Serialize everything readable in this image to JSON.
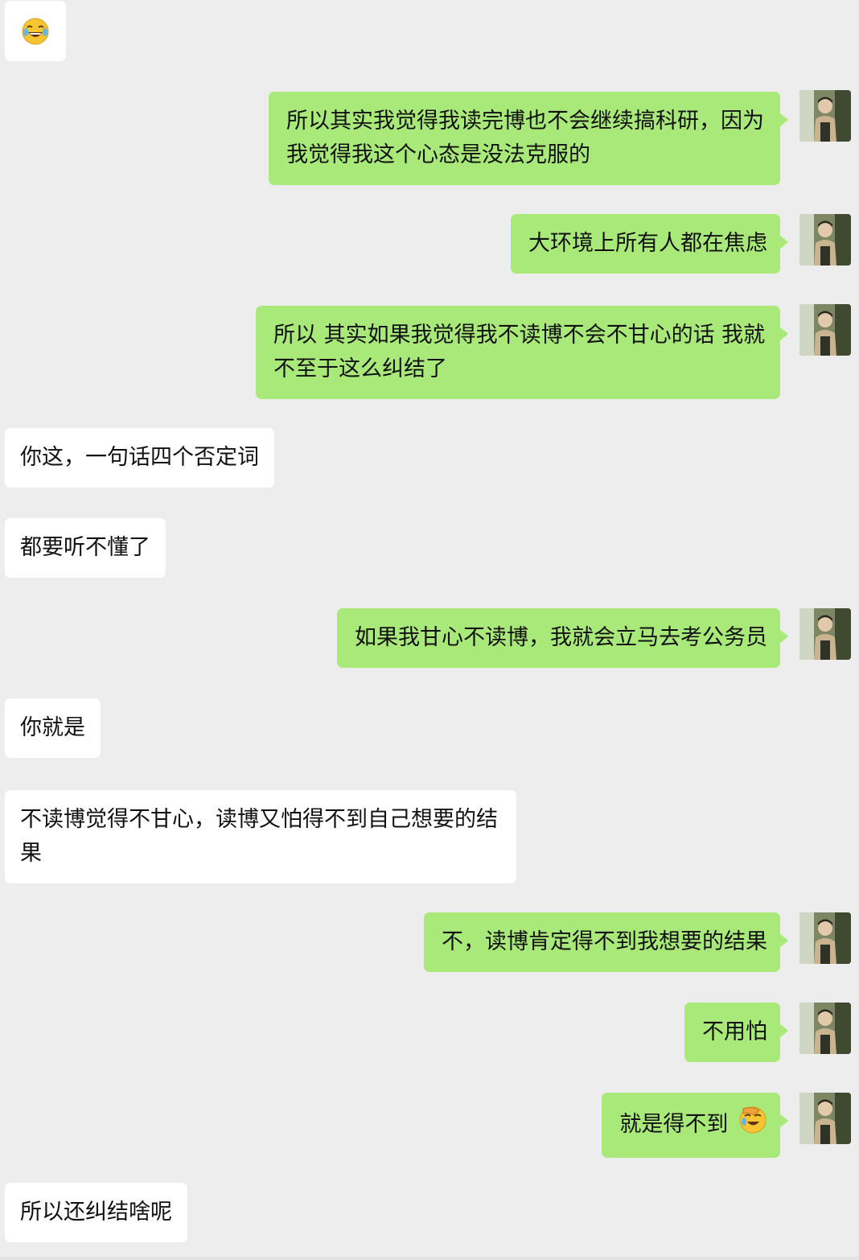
{
  "messages": [
    {
      "id": "m1",
      "side": "in",
      "text": "",
      "emoji": "laughing-tears-emoji"
    },
    {
      "id": "m2",
      "side": "out",
      "text": "所以其实我觉得我读完博也不会继续搞科研，因为我觉得我这个心态是没法克服的"
    },
    {
      "id": "m3",
      "side": "out",
      "text": "大环境上所有人都在焦虑"
    },
    {
      "id": "m4",
      "side": "out",
      "text": "所以 其实如果我觉得我不读博不会不甘心的话 我就不至于这么纠结了"
    },
    {
      "id": "m5",
      "side": "in",
      "text": "你这，一句话四个否定词"
    },
    {
      "id": "m6",
      "side": "in",
      "text": "都要听不懂了"
    },
    {
      "id": "m7",
      "side": "out",
      "text": "如果我甘心不读博，我就会立马去考公务员"
    },
    {
      "id": "m8",
      "side": "in",
      "text": "你就是"
    },
    {
      "id": "m9",
      "side": "in",
      "text": "不读博觉得不甘心，读博又怕得不到自己想要的结果"
    },
    {
      "id": "m10",
      "side": "out",
      "text": "不，读博肯定得不到我想要的结果"
    },
    {
      "id": "m11",
      "side": "out",
      "text": "不用怕"
    },
    {
      "id": "m12",
      "side": "out",
      "text": "就是得不到",
      "emoji": "facepalm-laugh-emoji"
    },
    {
      "id": "m13",
      "side": "in",
      "text": "所以还纠结啥呢"
    }
  ],
  "colors": {
    "background": "#ededed",
    "outgoing_bubble": "#a9e97a",
    "incoming_bubble": "#ffffff",
    "text": "#111111"
  }
}
